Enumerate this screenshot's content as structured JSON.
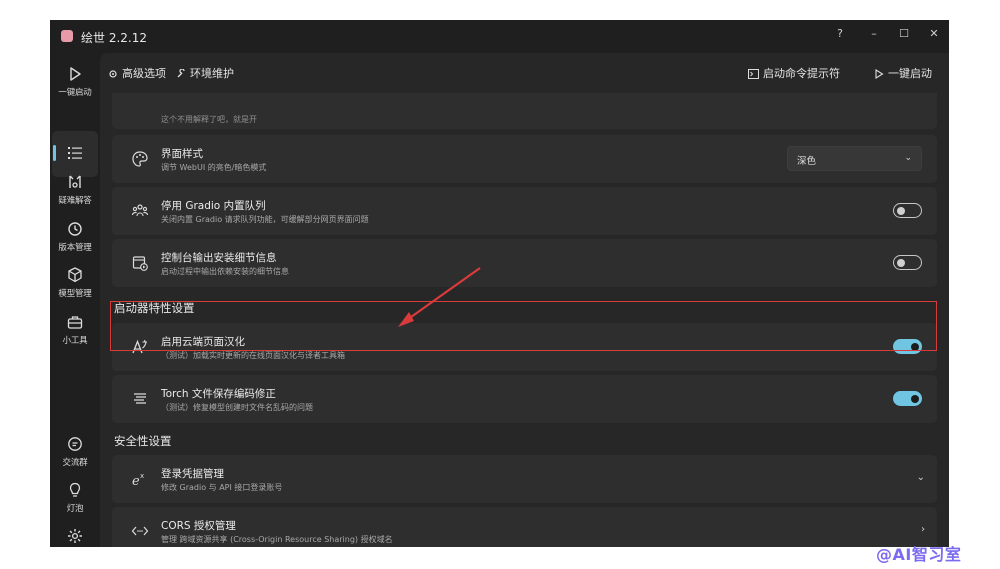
{
  "window": {
    "title": "绘世 2.2.12",
    "controls": [
      "?",
      "–",
      "☐",
      "✕"
    ]
  },
  "sidebar": {
    "items": [
      {
        "label": "一键启动",
        "icon": "play-icon"
      },
      {
        "label": "",
        "icon": "list-icon"
      },
      {
        "label": "疑难解答",
        "icon": "tools-icon"
      },
      {
        "label": "版本管理",
        "icon": "history-icon"
      },
      {
        "label": "模型管理",
        "icon": "cube-icon"
      },
      {
        "label": "小工具",
        "icon": "toolbox-icon"
      },
      {
        "label": "交流群",
        "icon": "chat-icon"
      },
      {
        "label": "灯泡",
        "icon": "bulb-icon"
      },
      {
        "label": "设置",
        "icon": "gear-icon"
      }
    ]
  },
  "toolbar": {
    "advanced": "高级选项",
    "env": "环境维护",
    "console": "启动命令提示符",
    "launch": "一键启动"
  },
  "cards": {
    "partial": {
      "desc": "这个不用解释了吧，就是开"
    },
    "ui_style": {
      "title": "界面样式",
      "desc": "调节 WebUI 的亮色/暗色模式",
      "value": "深色"
    },
    "gradio_queue": {
      "title": "停用 Gradio 内置队列",
      "desc": "关闭内置 Gradio 请求队列功能，可缓解部分网页界面问题",
      "enabled": false
    },
    "console_info": {
      "title": "控制台输出安装细节信息",
      "desc": "启动过程中输出依赖安装的细节信息",
      "enabled": false
    }
  },
  "sections": {
    "launcher": "启动器特性设置",
    "security": "安全性设置"
  },
  "launcher_cards": {
    "cloud_i18n": {
      "title": "启用云端页面汉化",
      "desc": "（测试）加载实时更新的在线页面汉化与译者工具箱",
      "enabled": true
    },
    "torch_fix": {
      "title": "Torch 文件保存编码修正",
      "desc": "（测试）修复模型创建时文件名乱码的问题",
      "enabled": true
    }
  },
  "security_cards": {
    "credentials": {
      "title": "登录凭据管理",
      "desc": "修改 Gradio 与 API 接口登录账号"
    },
    "cors": {
      "title": "CORS 授权管理",
      "desc": "管理 跨域资源共享 (Cross-Origin Resource Sharing) 授权域名"
    }
  },
  "watermark": "@AI智习室",
  "colors": {
    "accent": "#70c6e2",
    "highlight": "#d93a3a",
    "watermark": "#7b6bf0"
  }
}
